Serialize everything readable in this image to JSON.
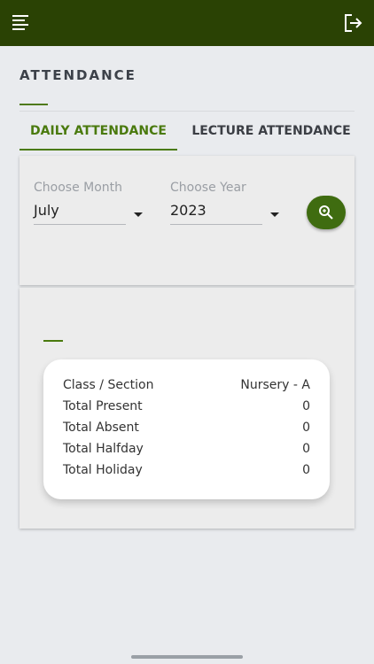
{
  "header": {
    "menu_icon": "menu-lines-icon",
    "logout_icon": "logout-icon",
    "background_color": "#2a4204"
  },
  "page": {
    "title": "ATTENDANCE"
  },
  "tabs": [
    {
      "label": "DAILY ATTENDANCE",
      "active": true
    },
    {
      "label": "LECTURE ATTENDANCE",
      "active": false
    }
  ],
  "filters": {
    "month": {
      "label": "Choose Month",
      "value": "July"
    },
    "year": {
      "label": "Choose Year",
      "value": "2023"
    },
    "search_icon": "search-icon"
  },
  "summary": {
    "rows": [
      {
        "label": "Class / Section",
        "value": "Nursery - A"
      },
      {
        "label": "Total Present",
        "value": "0"
      },
      {
        "label": "Total Absent",
        "value": "0"
      },
      {
        "label": "Total Halfday",
        "value": "0"
      },
      {
        "label": "Total Holiday",
        "value": "0"
      }
    ]
  },
  "colors": {
    "accent": "#4a7a0e",
    "button": "#3f6c10"
  }
}
